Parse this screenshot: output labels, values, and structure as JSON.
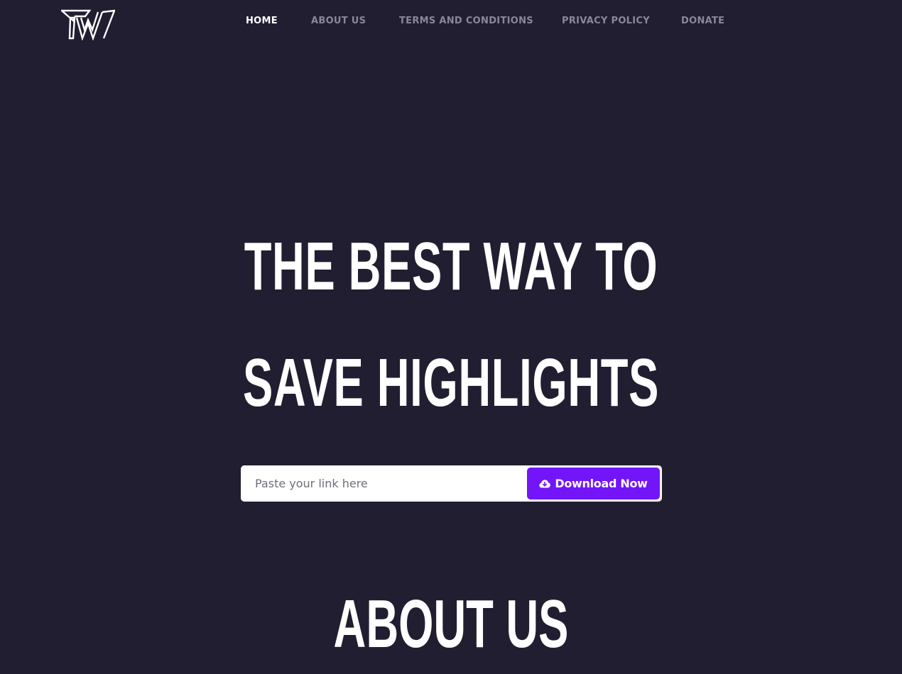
{
  "header": {
    "logo_icon": "tw-logo-icon",
    "nav": [
      {
        "label": "HOME",
        "active": true
      },
      {
        "label": "ABOUT US",
        "active": false
      },
      {
        "label": "TERMS AND CONDITIONS",
        "active": false
      },
      {
        "label": "PRIVACY POLICY",
        "active": false
      },
      {
        "label": "DONATE",
        "active": false
      }
    ]
  },
  "hero": {
    "line1": "THE BEST WAY TO",
    "line2": "SAVE HIGHLIGHTS",
    "input_placeholder": "Paste your link here",
    "input_value": "",
    "button_label": "Download Now",
    "button_icon": "cloud-download-icon"
  },
  "about": {
    "title": "ABOUT US"
  },
  "colors": {
    "background": "#201e30",
    "accent": "#7215f9",
    "nav_inactive": "#8a8898",
    "text": "#ffffff"
  }
}
